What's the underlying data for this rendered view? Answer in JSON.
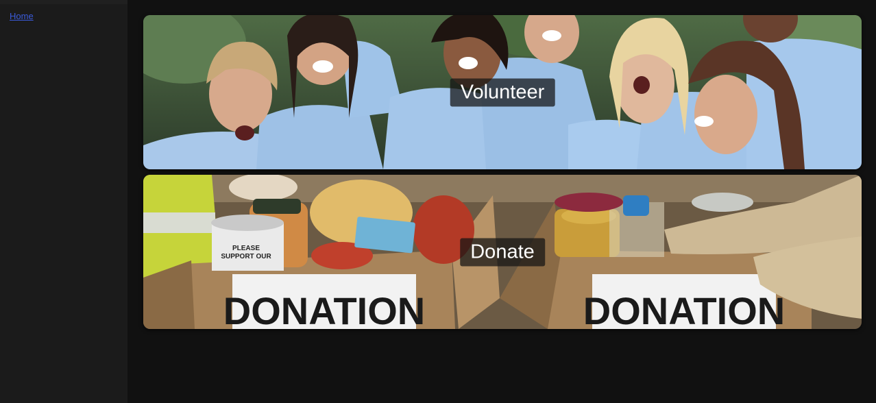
{
  "nav": {
    "home_label": "Home"
  },
  "cards": {
    "volunteer": {
      "label": "Volunteer",
      "image": "volunteer-group-photo"
    },
    "donate": {
      "label": "Donate",
      "image": "donation-boxes-photo",
      "box_text_left": "DONATION",
      "box_text_right": "DONATION",
      "can_text_1": "PLEASE",
      "can_text_2": "SUPPORT OUR",
      "tag_text": "DONATION"
    }
  },
  "colors": {
    "page_bg": "#111111",
    "sidebar_bg": "#1b1b1b",
    "link": "#3b5bdb",
    "shirt_blue": "#9fc3e8",
    "cardboard": "#b08a5e"
  }
}
